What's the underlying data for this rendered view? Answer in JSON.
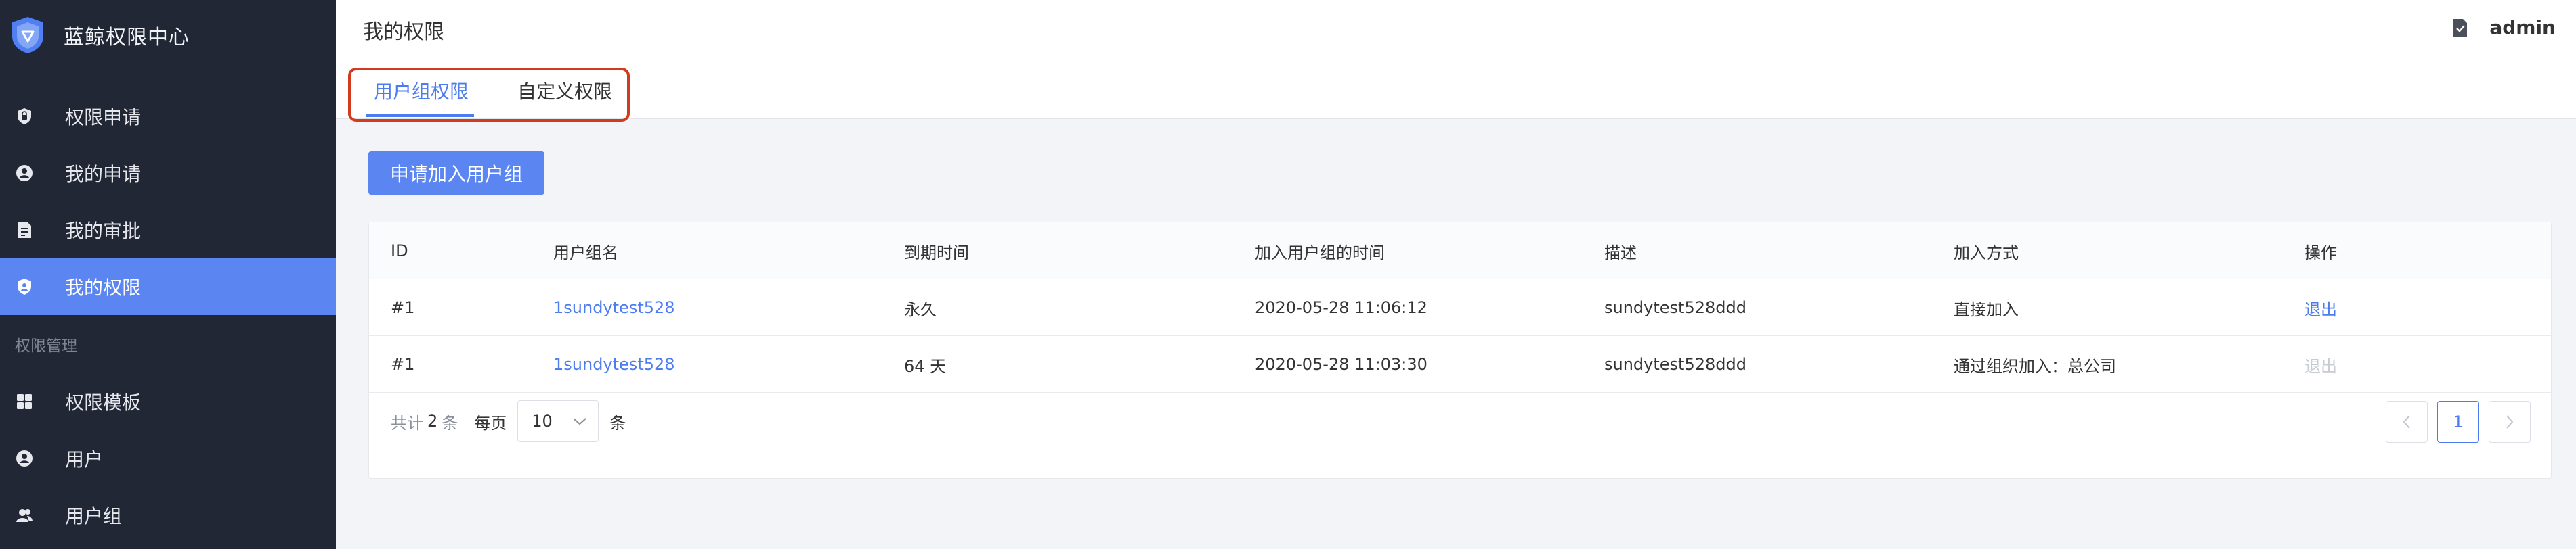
{
  "sidebar": {
    "brand_title": "蓝鲸权限中心",
    "items": [
      {
        "label": "权限申请",
        "icon": "shield-lock-icon"
      },
      {
        "label": "我的申请",
        "icon": "user-circle-icon"
      },
      {
        "label": "我的审批",
        "icon": "document-icon"
      },
      {
        "label": "我的权限",
        "icon": "shield-user-icon"
      }
    ],
    "group_label": "权限管理",
    "group_items": [
      {
        "label": "权限模板",
        "icon": "grid-icon"
      },
      {
        "label": "用户",
        "icon": "user-icon"
      },
      {
        "label": "用户组",
        "icon": "users-icon"
      }
    ]
  },
  "header": {
    "title": "我的权限",
    "user_name": "admin",
    "tabs": [
      {
        "label": "用户组权限"
      },
      {
        "label": "自定义权限"
      }
    ]
  },
  "main": {
    "apply_button": "申请加入用户组",
    "table": {
      "columns": [
        "ID",
        "用户组名",
        "到期时间",
        "加入用户组的时间",
        "描述",
        "加入方式",
        "操作"
      ],
      "rows": [
        {
          "id": "#1",
          "name": "1sundytest528",
          "expire": "永久",
          "joined": "2020-05-28 11:06:12",
          "desc": "sundytest528ddd",
          "method": "直接加入",
          "action": "退出"
        },
        {
          "id": "#1",
          "name": "1sundytest528",
          "expire": "64 天",
          "joined": "2020-05-28 11:03:30",
          "desc": "sundytest528ddd",
          "method": "通过组织加入：总公司",
          "action": "退出"
        }
      ]
    },
    "pagination": {
      "total_prefix": "共计",
      "total": "2",
      "total_suffix": "条",
      "per_page_prefix": "每页",
      "per_page": "10",
      "per_page_suffix": "条",
      "current_page": "1"
    }
  },
  "colors": {
    "sidebar_bg": "#212734",
    "accent": "#5b86f2",
    "link": "#4d7cf0",
    "highlight_box": "#d23c1e"
  }
}
